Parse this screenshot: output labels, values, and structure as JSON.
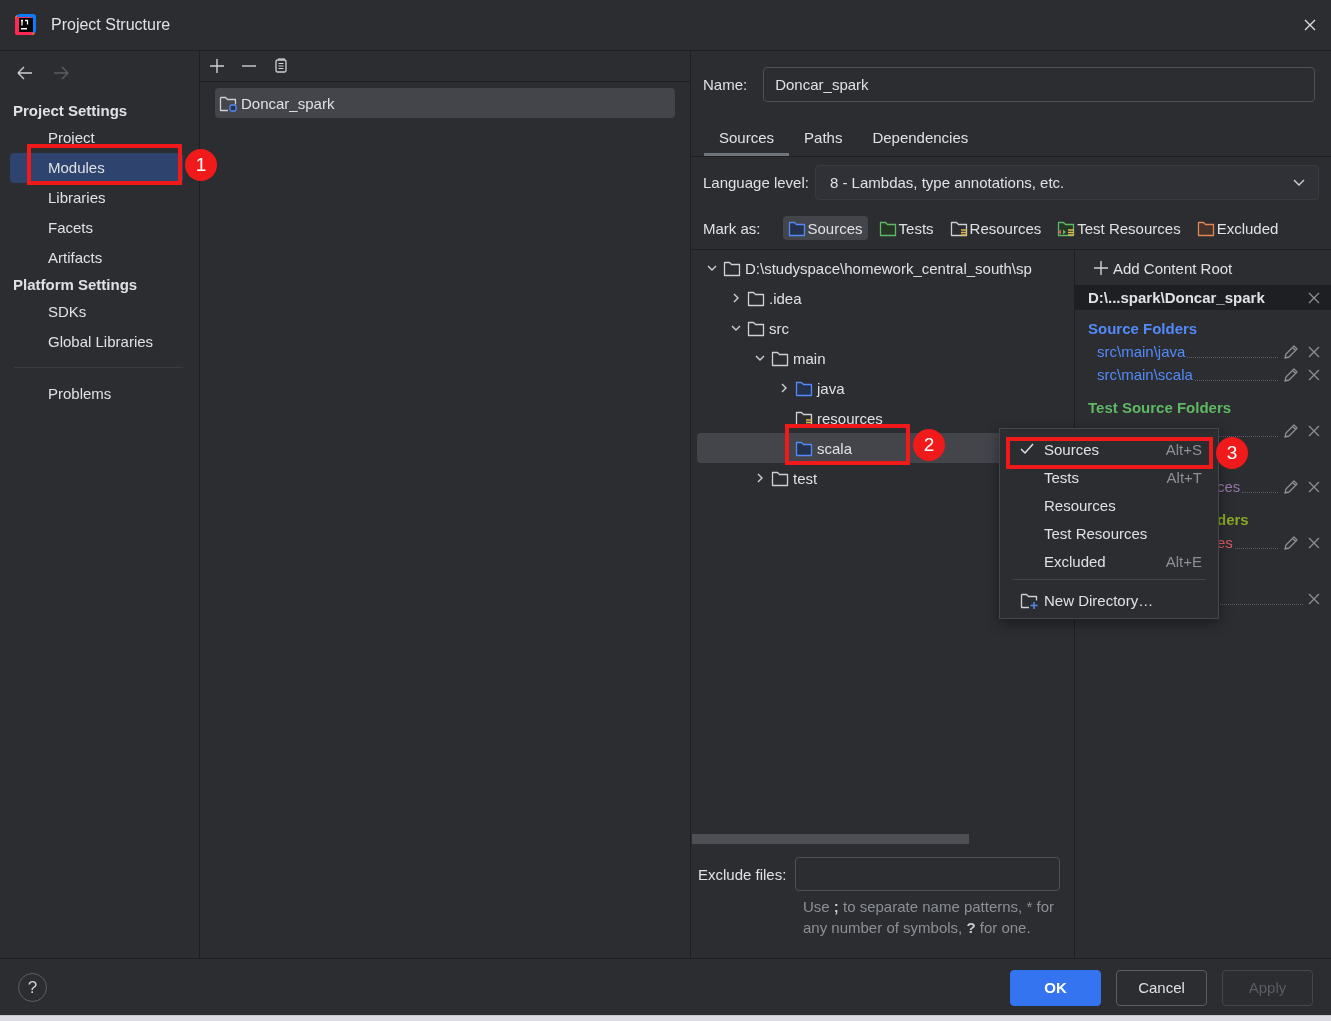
{
  "window": {
    "title": "Project Structure"
  },
  "sidebar": {
    "sections": [
      {
        "heading": "Project Settings",
        "items": [
          {
            "label": "Project",
            "selected": false
          },
          {
            "label": "Modules",
            "selected": true
          },
          {
            "label": "Libraries",
            "selected": false
          },
          {
            "label": "Facets",
            "selected": false
          },
          {
            "label": "Artifacts",
            "selected": false
          }
        ]
      },
      {
        "heading": "Platform Settings",
        "items": [
          {
            "label": "SDKs",
            "selected": false
          },
          {
            "label": "Global Libraries",
            "selected": false
          }
        ]
      },
      {
        "items": [
          {
            "label": "Problems",
            "selected": false
          }
        ]
      }
    ]
  },
  "modules": {
    "items": [
      {
        "label": "Doncar_spark",
        "selected": true
      }
    ]
  },
  "editor": {
    "name_label": "Name:",
    "name_value": "Doncar_spark",
    "tabs": [
      {
        "label": "Sources",
        "selected": true
      },
      {
        "label": "Paths",
        "selected": false
      },
      {
        "label": "Dependencies",
        "selected": false
      }
    ],
    "language_level": {
      "label": "Language level:",
      "value": "8 - Lambdas, type annotations, etc."
    },
    "mark_as": {
      "label": "Mark as:",
      "buttons": [
        {
          "label": "Sources",
          "kind": "sources",
          "selected": true
        },
        {
          "label": "Tests",
          "kind": "tests",
          "selected": false
        },
        {
          "label": "Resources",
          "kind": "resources",
          "selected": false
        },
        {
          "label": "Test Resources",
          "kind": "test-resources",
          "selected": false
        },
        {
          "label": "Excluded",
          "kind": "excluded",
          "selected": false
        }
      ]
    },
    "tree": {
      "label": "D:\\studyspace\\homework_central_south\\sp",
      "kind": "folder",
      "expanded": true,
      "selected": false,
      "children": [
        {
          "label": ".idea",
          "kind": "folder",
          "expanded": false,
          "selected": false
        },
        {
          "label": "src",
          "kind": "folder",
          "expanded": true,
          "selected": false,
          "children": [
            {
              "label": "main",
              "kind": "folder",
              "expanded": true,
              "selected": false,
              "children": [
                {
                  "label": "java",
                  "kind": "sources",
                  "expanded": false,
                  "selected": false
                },
                {
                  "label": "resources",
                  "kind": "resources",
                  "selected": false
                },
                {
                  "label": "scala",
                  "kind": "sources",
                  "selected": true
                }
              ]
            },
            {
              "label": "test",
              "kind": "folder",
              "expanded": false,
              "selected": false
            }
          ]
        }
      ]
    },
    "content_root": {
      "add_label": "Add Content Root",
      "path": "D:\\...spark\\Doncar_spark",
      "sections": [
        {
          "kind": "sources",
          "heading": "Source Folders",
          "rows": [
            {
              "path": "src\\main\\java",
              "editable": true
            },
            {
              "path": "src\\main\\scala",
              "editable": true
            }
          ]
        },
        {
          "kind": "tests",
          "heading": "Test Source Folders",
          "rows": [
            {
              "editable": true
            }
          ]
        },
        {
          "kind": "resources",
          "rows": [
            {
              "path": "ces",
              "cut": true,
              "editable": true
            }
          ]
        },
        {
          "kind": "test-resources",
          "heading": "ders",
          "cut": true,
          "rows": [
            {
              "path": "es",
              "cut": true,
              "editable": true
            }
          ]
        },
        {
          "kind": "excluded",
          "rows": [
            {
              "editable": false
            }
          ]
        }
      ]
    },
    "exclude_files": {
      "label": "Exclude files:",
      "hint": "Use **;** to separate name patterns, * for any number of symbols, **?** for one."
    }
  },
  "context_menu": {
    "items": [
      {
        "kind": "option",
        "label": "Sources",
        "shortcut": "Alt+S",
        "checked": true
      },
      {
        "kind": "option",
        "label": "Tests",
        "shortcut": "Alt+T",
        "checked": false
      },
      {
        "kind": "option",
        "label": "Resources",
        "checked": false
      },
      {
        "kind": "option",
        "label": "Test Resources",
        "checked": false
      },
      {
        "kind": "option",
        "label": "Excluded",
        "shortcut": "Alt+E",
        "checked": false
      },
      {
        "kind": "separator"
      },
      {
        "kind": "new-directory",
        "label": "New Directory…"
      }
    ]
  },
  "annotations": [
    {
      "label": "1"
    },
    {
      "label": "2"
    },
    {
      "label": "3"
    }
  ],
  "footer": {
    "help": "?",
    "buttons": [
      {
        "label": "OK",
        "kind": "primary",
        "disabled": false
      },
      {
        "label": "Cancel",
        "kind": "normal",
        "disabled": false
      },
      {
        "label": "Apply",
        "kind": "normal",
        "disabled": true
      }
    ]
  }
}
